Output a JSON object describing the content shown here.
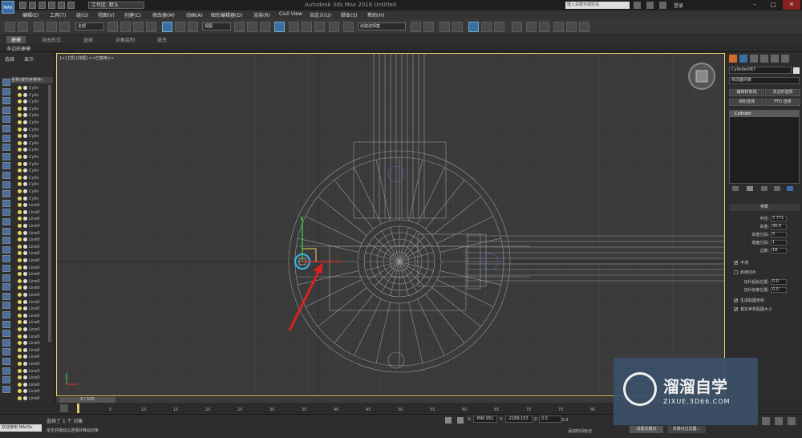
{
  "app": {
    "logo": "MAX",
    "title": "Autodesk 3ds Max 2016 Untitled",
    "workspace": "工作区: 默认",
    "search_placeholder": "键入关键字或短语",
    "login": "登录"
  },
  "menu": [
    "编辑(E)",
    "工具(T)",
    "组(G)",
    "视图(V)",
    "创建(C)",
    "修改器(M)",
    "动画(A)",
    "图形编辑器(D)",
    "渲染(R)",
    "Civil View",
    "自定义(U)",
    "脚本(S)",
    "帮助(H)"
  ],
  "toolbar": {
    "filter": "全部",
    "ref_coord": "视图",
    "selection_set": "创建选择集"
  },
  "ribbon": {
    "tabs": [
      "建模",
      "自由形式",
      "选择",
      "对象绘制",
      "填充"
    ],
    "sub": "多边形建模"
  },
  "scene_explorer": {
    "tabs": [
      "选择",
      "显示"
    ],
    "header": "名称(按升序排序)",
    "items": [
      "Cylin",
      "Cylin",
      "Cylin",
      "Cylin",
      "Cylin",
      "Cylin",
      "Cylin",
      "Cylin",
      "Cylin",
      "Cylin",
      "Cylin",
      "Cylin",
      "Cylin",
      "Cylin",
      "Cylin",
      "Cylin",
      "Cylin",
      "Line0",
      "Line0",
      "Line0",
      "Line0",
      "Line0",
      "Line0",
      "Line0",
      "Line0",
      "Line0",
      "Line0",
      "Line0",
      "Line0",
      "Line0",
      "Line0",
      "Line0",
      "Line0",
      "Line0",
      "Line0",
      "Line0",
      "Line0",
      "Line0",
      "Line0",
      "Line0",
      "Line0",
      "Line0",
      "Line0",
      "Line0",
      "Line0",
      "Line0",
      "Line0",
      "Line0"
    ]
  },
  "viewport": {
    "label": "[+] [顶] [线框] <<已禁用>>"
  },
  "command_panel": {
    "object_name": "Cylinder067",
    "modifier_list": "修改器列表",
    "buttons": [
      "编辑样条线",
      "多边形选择",
      "体积选择",
      "FFD 选择"
    ],
    "stack_item": "Cylinder",
    "rollout": "参数",
    "params": [
      {
        "label": "半径:",
        "value": "7.771"
      },
      {
        "label": "高度:",
        "value": "90.0"
      },
      {
        "label": "高度分段:",
        "value": "5"
      },
      {
        "label": "端面分段:",
        "value": "1"
      },
      {
        "label": "边数:",
        "value": "18"
      }
    ],
    "smooth": "平滑",
    "slice_on": "启用切片",
    "slice_from": "切片起始位置:",
    "slice_to": "切片结束位置:",
    "slice_from_val": "0.0",
    "slice_to_val": "0.0",
    "gen_map": "生成贴图坐标",
    "real_world": "真实世界贴图大小"
  },
  "timeline": {
    "frame": "0 / 100",
    "ticks": [
      "0",
      "5",
      "10",
      "15",
      "20",
      "25",
      "30",
      "35",
      "40",
      "45",
      "50",
      "55",
      "60",
      "65",
      "70",
      "75",
      "80",
      "85"
    ]
  },
  "status": {
    "selected": "选择了 1 个 对象",
    "prompt": "单击并拖动以选择并移动对象",
    "welcome": "欢迎使用 MAXSc",
    "x_label": "X:",
    "x": "-896.951",
    "y_label": "Y:",
    "y": "-2189.153",
    "z_label": "Z:",
    "z": "0.0",
    "grid": "栅格 = 10.0",
    "add_time_tag": "添加时间标记",
    "set_key": "设置关键点",
    "key_filter": "关键点过滤器..."
  },
  "watermark": {
    "title": "溜溜自学",
    "url": "ZIXUE.3D66.COM"
  },
  "colors": {
    "accent": "#3a6ea5",
    "viewport_border": "#e8d060",
    "arrow": "#e02020",
    "selection": "#38b8f0"
  }
}
